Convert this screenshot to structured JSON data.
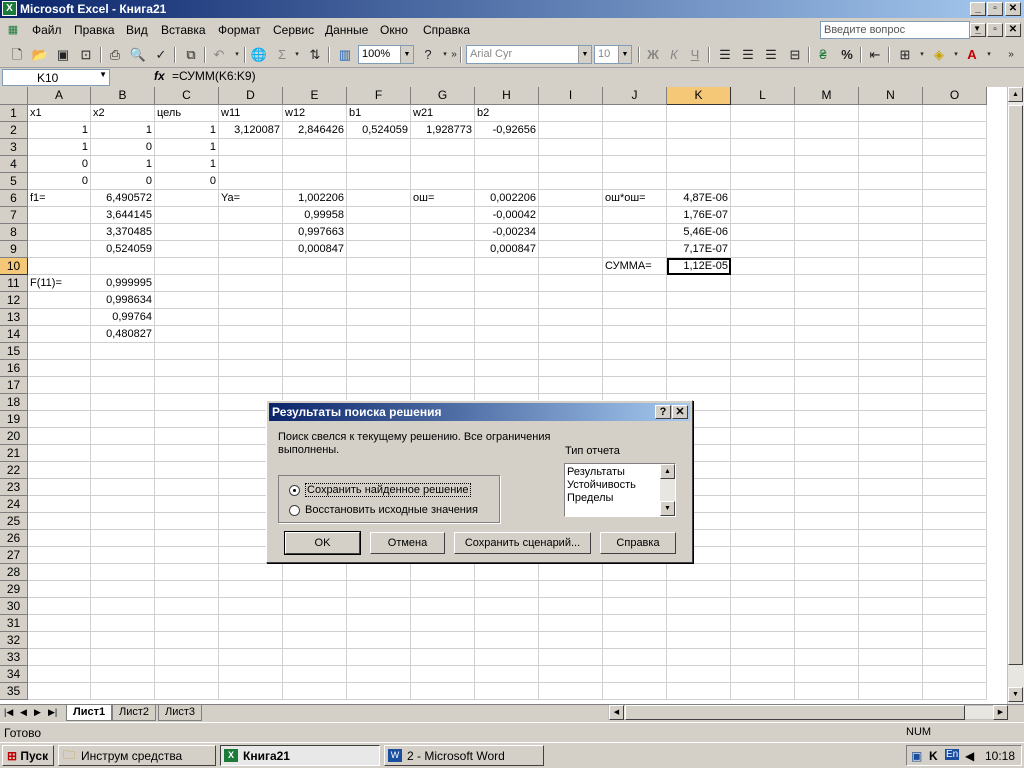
{
  "window": {
    "title": "Microsoft Excel - Книга21",
    "app_icon": "excel-icon"
  },
  "menu": {
    "items": [
      "Файл",
      "Правка",
      "Вид",
      "Вставка",
      "Формат",
      "Сервис",
      "Данные",
      "Окно",
      "Справка"
    ],
    "help_placeholder": "Введите вопрос"
  },
  "toolbar": {
    "zoom": "100%",
    "font": "Arial Cyr",
    "size": "10"
  },
  "formula_bar": {
    "name_box": "K10",
    "fx": "fx",
    "formula": "=СУММ(K6:K9)"
  },
  "columns": [
    "A",
    "B",
    "C",
    "D",
    "E",
    "F",
    "G",
    "H",
    "I",
    "J",
    "K",
    "L",
    "M",
    "N",
    "O"
  ],
  "rows": [
    "1",
    "2",
    "3",
    "4",
    "5",
    "6",
    "7",
    "8",
    "9",
    "10",
    "11",
    "12",
    "13",
    "14",
    "15",
    "16",
    "17",
    "18",
    "19",
    "20",
    "21",
    "22",
    "23",
    "24",
    "25",
    "26",
    "27",
    "28",
    "29",
    "30",
    "31",
    "32",
    "33",
    "34",
    "35"
  ],
  "cells": {
    "A1": "x1",
    "B1": "x2",
    "C1": "цель",
    "D1": "w11",
    "E1": "w12",
    "F1": "b1",
    "G1": "w21",
    "H1": "b2",
    "A2": "1",
    "B2": "1",
    "C2": "1",
    "D2": "3,120087",
    "E2": "2,846426",
    "F2": "0,524059",
    "G2": "1,928773",
    "H2": "-0,92656",
    "A3": "1",
    "B3": "0",
    "C3": "1",
    "A4": "0",
    "B4": "1",
    "C4": "1",
    "A5": "0",
    "B5": "0",
    "C5": "0",
    "A6": "f1=",
    "B6": "6,490572",
    "D6": "Ya=",
    "E6": "1,002206",
    "G6": "ош=",
    "H6": "0,002206",
    "J6": "ош*ош=",
    "K6": "4,87E-06",
    "B7": "3,644145",
    "E7": "0,99958",
    "H7": "-0,00042",
    "K7": "1,76E-07",
    "B8": "3,370485",
    "E8": "0,997663",
    "H8": "-0,00234",
    "K8": "5,46E-06",
    "B9": "0,524059",
    "E9": "0,000847",
    "H9": "0,000847",
    "K9": "7,17E-07",
    "J10": "СУММА=",
    "K10": "1,12E-05",
    "A11": "F(11)=",
    "B11": "0,999995",
    "B12": "0,998634",
    "B13": "0,99764",
    "B14": "0,480827"
  },
  "sheets": {
    "tabs": [
      "Лист1",
      "Лист2",
      "Лист3"
    ],
    "active": "Лист1"
  },
  "status": {
    "left": "Готово",
    "num": "NUM"
  },
  "dialog": {
    "title": "Результаты поиска решения",
    "message": "Поиск свелся к текущему решению. Все ограничения выполнены.",
    "option_keep": "Сохранить найденное решение",
    "option_restore": "Восстановить исходные значения",
    "report_label": "Тип отчета",
    "reports": [
      "Результаты",
      "Устойчивость",
      "Пределы"
    ],
    "btn_ok": "OK",
    "btn_cancel": "Отмена",
    "btn_save_scenario": "Сохранить сценарий...",
    "btn_help": "Справка"
  },
  "taskbar": {
    "start": "Пуск",
    "tasks": [
      "Инструм средства",
      "Книга21",
      "2 - Microsoft Word"
    ],
    "tray_lang": "En",
    "clock": "10:18"
  }
}
